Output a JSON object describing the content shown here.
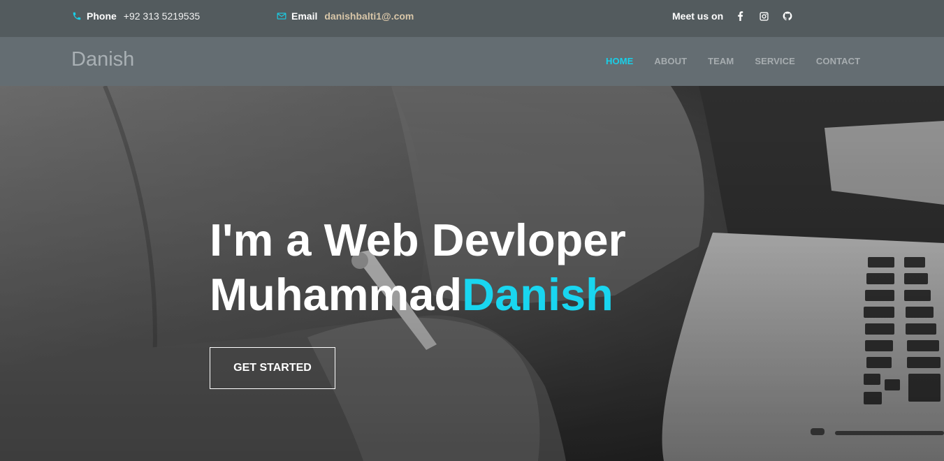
{
  "topbar": {
    "phone_label": "Phone",
    "phone_value": "+92 313 5219535",
    "email_label": "Email",
    "email_value": "danishbalti1@.com",
    "social_label": "Meet us on",
    "social_icons": [
      "facebook-icon",
      "instagram-icon",
      "github-icon"
    ]
  },
  "navbar": {
    "brand": "Danish",
    "items": [
      {
        "label": "HOME",
        "active": true
      },
      {
        "label": "ABOUT"
      },
      {
        "label": "TEAM"
      },
      {
        "label": "SERVICE"
      },
      {
        "label": "CONTACT"
      }
    ]
  },
  "hero": {
    "line1": "I'm a Web Devloper",
    "line2_plain": "Muhammad",
    "line2_accent": "Danish",
    "cta": "GET STARTED"
  },
  "colors": {
    "accent": "#19d6f0",
    "topbar_bg": "#535b5e",
    "navbar_bg": "#646d72"
  }
}
